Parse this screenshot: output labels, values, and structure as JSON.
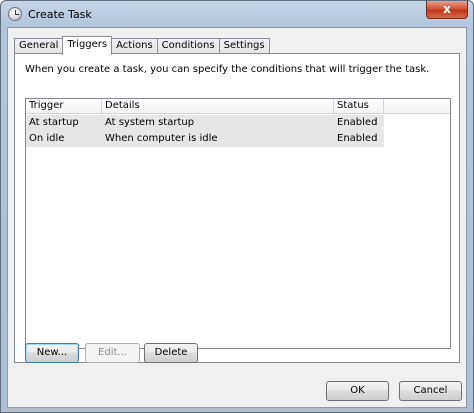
{
  "window": {
    "title": "Create Task",
    "close_glyph": "x"
  },
  "tabs": [
    {
      "label": "General"
    },
    {
      "label": "Triggers"
    },
    {
      "label": "Actions"
    },
    {
      "label": "Conditions"
    },
    {
      "label": "Settings"
    }
  ],
  "active_tab": "Triggers",
  "description": "When you create a task, you can specify the conditions that will trigger the task.",
  "grid": {
    "columns": [
      "Trigger",
      "Details",
      "Status"
    ],
    "rows": [
      {
        "trigger": "At startup",
        "details": "At system startup",
        "status": "Enabled"
      },
      {
        "trigger": "On idle",
        "details": "When computer is idle",
        "status": "Enabled"
      }
    ]
  },
  "buttons": {
    "new": "New...",
    "edit": "Edit...",
    "delete": "Delete",
    "ok": "OK",
    "cancel": "Cancel"
  },
  "colors": {
    "close_button": "#c1361a",
    "row_highlight": "#e6e6e6"
  }
}
